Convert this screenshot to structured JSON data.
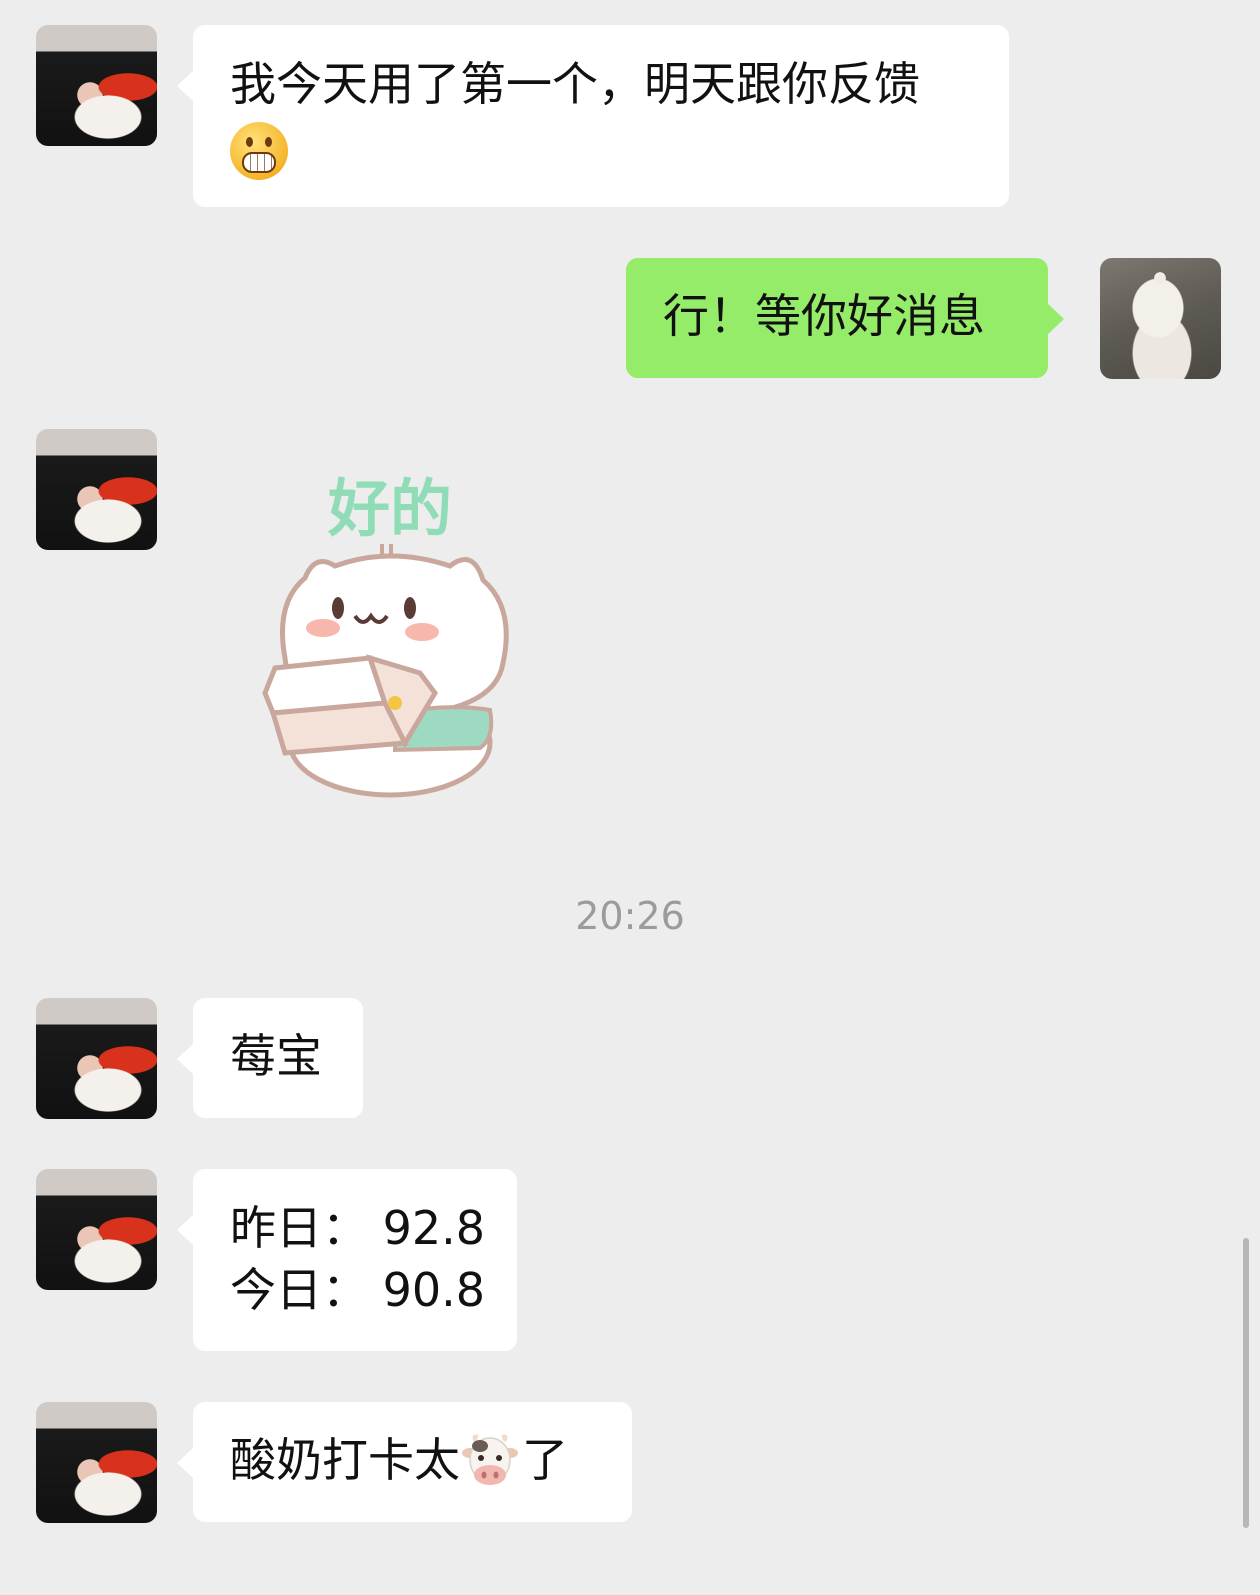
{
  "messages": [
    {
      "from": "them",
      "line1": "我今天用了第一个，明天跟你反馈",
      "emoji": "grinning-face-emoji"
    },
    {
      "from": "me",
      "text": "行！等你好消息"
    },
    {
      "from": "them",
      "sticker": "cat-sticker",
      "sticker_text": "好的"
    },
    {
      "from": "them",
      "text": "莓宝"
    },
    {
      "from": "them",
      "line1": "昨日：  92.8",
      "line2": "今日：  90.8"
    },
    {
      "from": "them",
      "before": "酸奶打卡太",
      "emoji": "cow-face-emoji",
      "after": "了"
    }
  ],
  "timestamp": "20:26",
  "colors": {
    "background": "#ededed",
    "sent_bubble": "#95ec69",
    "received_bubble": "#ffffff",
    "timestamp": "#9b9b9b"
  }
}
